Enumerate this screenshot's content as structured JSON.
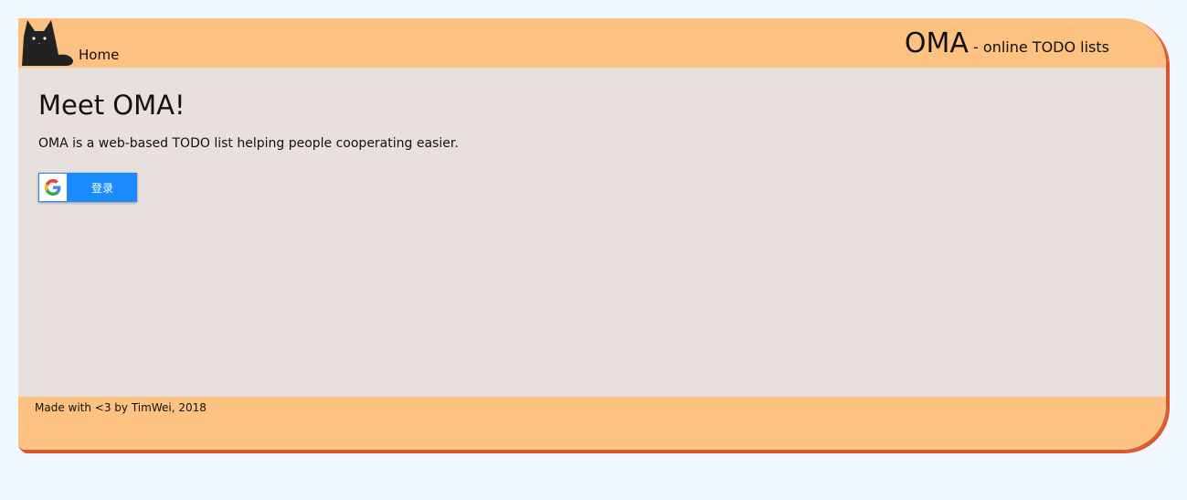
{
  "header": {
    "home_label": "Home",
    "brand_name": "OMA",
    "brand_tagline": " - online TODO lists",
    "logo_icon": "black-cat-icon"
  },
  "main": {
    "heading": "Meet OMA!",
    "description": "OMA is a web-based TODO list helping people cooperating easier.",
    "signin_label": "登录",
    "signin_icon": "google-icon"
  },
  "footer": {
    "credit": "Made with <3 by TimWei, 2018"
  },
  "colors": {
    "page_bg": "#f0f7ff",
    "header_bg": "#fdc282",
    "main_bg": "#e8e0dc",
    "accent_border": "#d9572e",
    "button_bg": "#1a8cff"
  }
}
